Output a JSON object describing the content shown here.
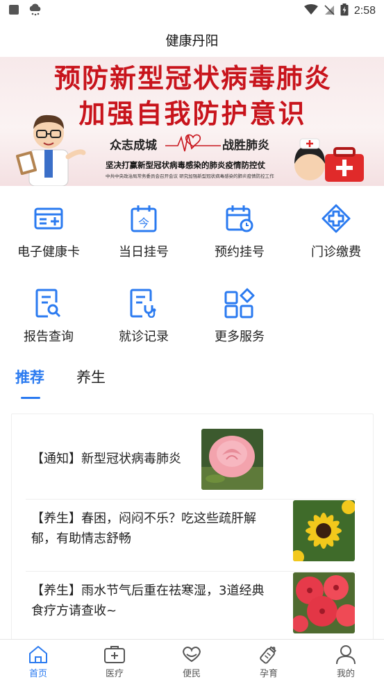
{
  "status_bar": {
    "time": "2:58"
  },
  "header": {
    "title": "健康丹阳"
  },
  "banner": {
    "line1": "预防新型冠状病毒肺炎",
    "line2": "加强自我防护意识",
    "slogan_left": "众志成城",
    "slogan_right": "战胜肺炎",
    "line4": "坚决打赢新型冠状病毒感染的肺炎疫情防控仗",
    "line5": "中共中央政治局常务委员会召开会议 研究加强新型冠状病毒感染的肺炎疫情防控工作"
  },
  "menu": {
    "items": [
      {
        "label": "电子健康卡",
        "icon": "health-card-icon"
      },
      {
        "label": "当日挂号",
        "icon": "today-calendar-icon"
      },
      {
        "label": "预约挂号",
        "icon": "appointment-calendar-icon"
      },
      {
        "label": "门诊缴费",
        "icon": "medical-cross-icon"
      },
      {
        "label": "报告查询",
        "icon": "report-search-icon"
      },
      {
        "label": "就诊记录",
        "icon": "visit-record-icon"
      },
      {
        "label": "更多服务",
        "icon": "more-services-icon"
      }
    ]
  },
  "tabs": {
    "active": "推荐",
    "inactive": "养生"
  },
  "articles": [
    {
      "text": "【通知】新型冠状病毒肺炎",
      "thumb": "pink-rose"
    },
    {
      "text": "【养生】春困，闷闷不乐？吃这些疏肝解郁，有助情志舒畅",
      "line1": "【养生】春困，闷闷不乐？吃这些疏肝解",
      "line2": "郁，有助情志舒畅",
      "thumb": "yellow-flower"
    },
    {
      "text": "【养生】雨水节气后重在祛寒湿，3道经典食疗方请查收~",
      "line1": "【养生】雨水节气后重在祛寒湿，3道经典",
      "line2": "食疗方请查收~",
      "thumb": "red-flowers"
    }
  ],
  "bottom_nav": {
    "items": [
      {
        "label": "首页",
        "icon": "home-icon",
        "active": true
      },
      {
        "label": "医疗",
        "icon": "medical-kit-icon"
      },
      {
        "label": "便民",
        "icon": "heart-hand-icon"
      },
      {
        "label": "孕育",
        "icon": "baby-bottle-icon"
      },
      {
        "label": "我的",
        "icon": "user-icon"
      }
    ]
  },
  "colors": {
    "accent": "#2a7af0",
    "banner_red": "#c8141c"
  }
}
